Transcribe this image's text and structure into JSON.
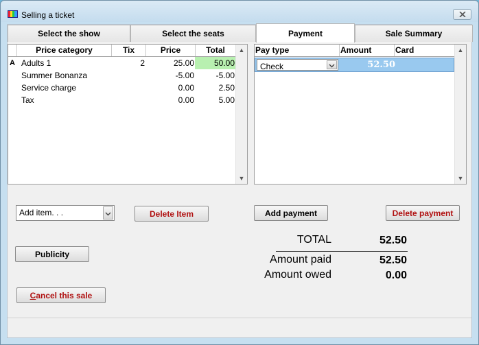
{
  "window": {
    "title": "Selling a ticket"
  },
  "tabs": [
    {
      "label": "Select the show",
      "active": false
    },
    {
      "label": "Select the seats",
      "active": false
    },
    {
      "label": "Payment",
      "active": true
    },
    {
      "label": "Sale Summary",
      "active": false
    }
  ],
  "items_table": {
    "columns": [
      "",
      "Price category",
      "Tix",
      "Price",
      "Total"
    ],
    "rows": [
      {
        "marker": "A",
        "category": "Adults 1",
        "tix": "2",
        "price": "25.00",
        "total": "50.00"
      },
      {
        "marker": "",
        "category": "Summer Bonanza",
        "tix": "",
        "price": "-5.00",
        "total": "-5.00"
      },
      {
        "marker": "",
        "category": "Service charge",
        "tix": "",
        "price": "0.00",
        "total": "2.50"
      },
      {
        "marker": "",
        "category": "Tax",
        "tix": "",
        "price": "0.00",
        "total": "5.00"
      }
    ],
    "highlight_color": "#b8f0b0"
  },
  "payments_table": {
    "columns": [
      "Pay type",
      "Amount",
      "Card"
    ],
    "rows": [
      {
        "pay_type": "Check",
        "amount": "52.50",
        "card": ""
      }
    ],
    "selected_color": "#99c9ef"
  },
  "controls": {
    "add_item": "Add item. . .",
    "delete_item": "Delete Item",
    "add_payment": "Add payment",
    "delete_payment": "Delete payment",
    "publicity": "Publicity",
    "cancel_sale": "Cancel this sale",
    "cancel_accel": "C",
    "cancel_rest": "ancel this sale"
  },
  "totals": {
    "total_label": "TOTAL",
    "total_value": "52.50",
    "paid_label": "Amount paid",
    "paid_value": "52.50",
    "owed_label": "Amount owed",
    "owed_value": "0.00"
  }
}
